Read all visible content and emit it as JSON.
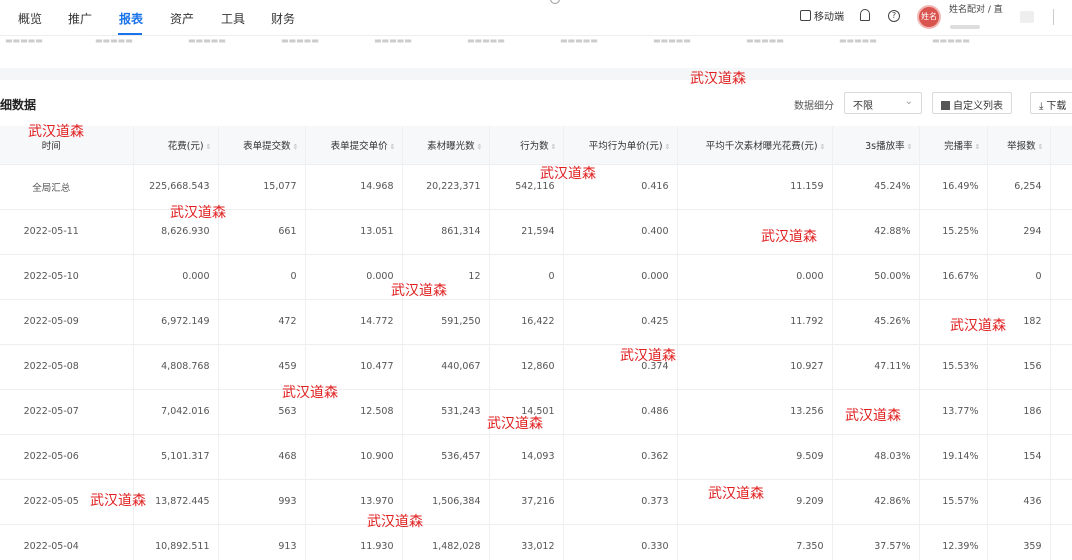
{
  "nav": {
    "items": [
      "概览",
      "推广",
      "报表",
      "资产",
      "工具",
      "财务"
    ],
    "active_index": 2,
    "mobile_label": "移动端",
    "help_glyph": "?",
    "avatar_text": "姓名",
    "username": "姓名配对 / 直"
  },
  "section": {
    "title": "详细数据",
    "filter_label": "数据细分",
    "filter_value": "不限",
    "custom_columns_label": "自定义列表",
    "download_label": "下载"
  },
  "table": {
    "columns": [
      "时间",
      "花费(元)",
      "表单提交数",
      "表单提交单价",
      "素材曝光数",
      "行为数",
      "平均行为单价(元)",
      "平均千次素材曝光花费(元)",
      "3s播放率",
      "完播率",
      "举报数"
    ],
    "rows": [
      [
        "全局汇总",
        "225,668.543",
        "15,077",
        "14.968",
        "20,223,371",
        "542,116",
        "0.416",
        "11.159",
        "45.24%",
        "16.49%",
        "6,254"
      ],
      [
        "2022-05-11",
        "8,626.930",
        "661",
        "13.051",
        "861,314",
        "21,594",
        "0.400",
        "",
        "42.88%",
        "15.25%",
        "294"
      ],
      [
        "2022-05-10",
        "0.000",
        "0",
        "0.000",
        "12",
        "0",
        "0.000",
        "0.000",
        "50.00%",
        "16.67%",
        "0"
      ],
      [
        "2022-05-09",
        "6,972.149",
        "472",
        "14.772",
        "591,250",
        "16,422",
        "0.425",
        "11.792",
        "45.26%",
        "",
        "182"
      ],
      [
        "2022-05-08",
        "4,808.768",
        "459",
        "10.477",
        "440,067",
        "12,860",
        "0.374",
        "10.927",
        "47.11%",
        "15.53%",
        "156"
      ],
      [
        "2022-05-07",
        "7,042.016",
        "563",
        "12.508",
        "531,243",
        "14,501",
        "0.486",
        "13.256",
        "",
        "13.77%",
        "186"
      ],
      [
        "2022-05-06",
        "5,101.317",
        "468",
        "10.900",
        "536,457",
        "14,093",
        "0.362",
        "9.509",
        "48.03%",
        "19.14%",
        "154"
      ],
      [
        "2022-05-05",
        "13,872.445",
        "993",
        "13.970",
        "1,506,384",
        "37,216",
        "0.373",
        "9.209",
        "42.86%",
        "15.57%",
        "436"
      ],
      [
        "2022-05-04",
        "10,892.511",
        "913",
        "11.930",
        "1,482,028",
        "33,012",
        "0.330",
        "7.350",
        "37.57%",
        "12.39%",
        "359"
      ]
    ]
  },
  "watermark": "武汉道森",
  "colors": {
    "accent": "#1a73e8",
    "watermark": "#e02020"
  }
}
